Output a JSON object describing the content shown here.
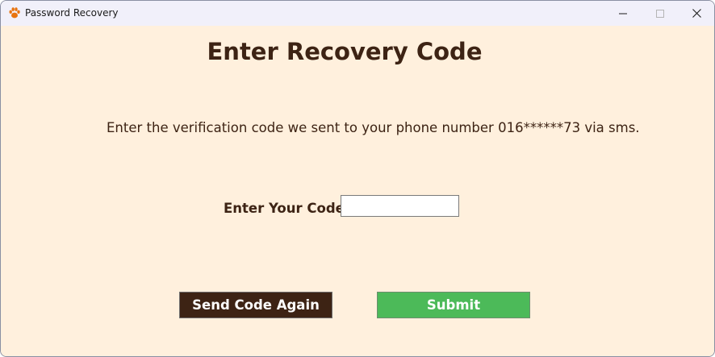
{
  "window": {
    "title": "Password Recovery",
    "app_icon": "paw-icon",
    "controls": [
      "minimize-icon",
      "maximize-icon",
      "close-icon"
    ]
  },
  "content": {
    "heading": "Enter Recovery Code",
    "instructions": "Enter the verification code we sent to your phone number 016******73 via sms.",
    "code_field": {
      "label": "Enter Your Code",
      "value": "",
      "placeholder": ""
    }
  },
  "buttons": {
    "resend_label": "Send Code Again",
    "submit_label": "Submit"
  },
  "colors": {
    "background": "#fff0dd",
    "text": "#3d2314",
    "resend_button": "#3d2314",
    "submit_button": "#4cba59",
    "titlebar": "#f1f0fa"
  }
}
